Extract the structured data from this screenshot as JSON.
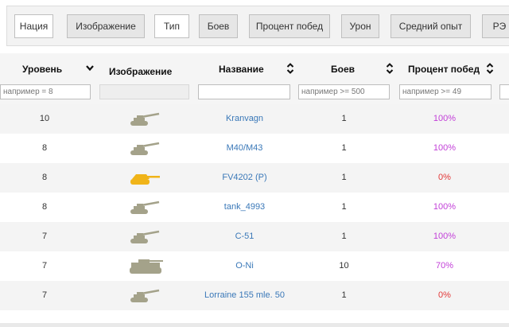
{
  "toggles": [
    {
      "label": "Нация",
      "active": true
    },
    {
      "label": "Изображение",
      "active": false
    },
    {
      "label": "Тип",
      "active": true
    },
    {
      "label": "Боев",
      "active": false
    },
    {
      "label": "Процент побед",
      "active": false
    },
    {
      "label": "Урон",
      "active": false
    },
    {
      "label": "Средний опыт",
      "active": false
    },
    {
      "label": "РЭ",
      "active": false
    }
  ],
  "columns": {
    "level": {
      "label": "Уровень",
      "icon": "chevron-down-icon",
      "filter_placeholder": "например = 8"
    },
    "image": {
      "label": "Изображение"
    },
    "name": {
      "label": "Название",
      "icon": "sort-icon",
      "filter_placeholder": ""
    },
    "battles": {
      "label": "Боев",
      "icon": "sort-icon",
      "filter_placeholder": "например >= 500"
    },
    "winrate": {
      "label": "Процент побед",
      "icon": "sort-icon",
      "filter_placeholder": "например >= 49"
    }
  },
  "rows": [
    {
      "level": "10",
      "tank_icon": "tank-spg-icon",
      "tank_color": "#a4a28a",
      "name": "Kranvagn",
      "battles": "1",
      "winrate": "100%",
      "winrate_color": "#c23fd8"
    },
    {
      "level": "8",
      "tank_icon": "tank-spg-icon",
      "tank_color": "#a4a28a",
      "name": "M40/M43",
      "battles": "1",
      "winrate": "100%",
      "winrate_color": "#c23fd8"
    },
    {
      "level": "8",
      "tank_icon": "tank-td-icon",
      "tank_color": "#f0b419",
      "name": "FV4202 (P)",
      "battles": "1",
      "winrate": "0%",
      "winrate_color": "#e23838"
    },
    {
      "level": "8",
      "tank_icon": "tank-spg-icon",
      "tank_color": "#a4a28a",
      "name": "tank_4993",
      "battles": "1",
      "winrate": "100%",
      "winrate_color": "#c23fd8"
    },
    {
      "level": "7",
      "tank_icon": "tank-spg-icon",
      "tank_color": "#a4a28a",
      "name": "C-51",
      "battles": "1",
      "winrate": "100%",
      "winrate_color": "#c23fd8"
    },
    {
      "level": "7",
      "tank_icon": "tank-heavy-icon",
      "tank_color": "#a4a28a",
      "name": "O-Ni",
      "battles": "10",
      "winrate": "70%",
      "winrate_color": "#c23fd8"
    },
    {
      "level": "7",
      "tank_icon": "tank-spg-icon",
      "tank_color": "#a4a28a",
      "name": "Lorraine 155 mle. 50",
      "battles": "1",
      "winrate": "0%",
      "winrate_color": "#e23838"
    }
  ],
  "colors": {
    "link": "#3a78b8",
    "win_high": "#c23fd8",
    "win_low": "#e23838"
  }
}
